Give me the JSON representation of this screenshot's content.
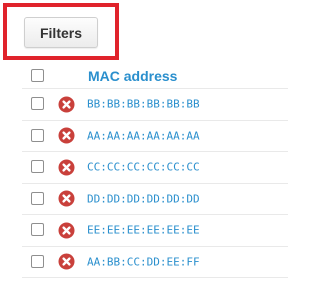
{
  "toolbar": {
    "filters_label": "Filters"
  },
  "colors": {
    "highlight": "#e0232b",
    "link": "#2a8fcd",
    "delete_icon": "#c9403b"
  },
  "table": {
    "column_header": "MAC address",
    "rows": [
      {
        "mac": "BB:BB:BB:BB:BB:BB",
        "action_icon": "delete-icon"
      },
      {
        "mac": "AA:AA:AA:AA:AA:AA",
        "action_icon": "delete-icon"
      },
      {
        "mac": "CC:CC:CC:CC:CC:CC",
        "action_icon": "delete-icon"
      },
      {
        "mac": "DD:DD:DD:DD:DD:DD",
        "action_icon": "delete-icon"
      },
      {
        "mac": "EE:EE:EE:EE:EE:EE",
        "action_icon": "delete-icon"
      },
      {
        "mac": "AA:BB:CC:DD:EE:FF",
        "action_icon": "delete-icon"
      }
    ]
  }
}
